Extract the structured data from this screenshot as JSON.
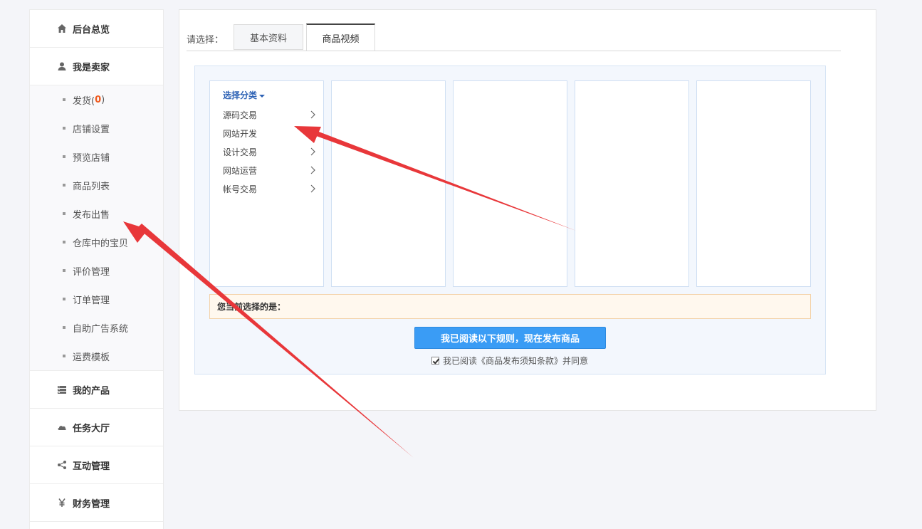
{
  "sidebar": {
    "sections": [
      {
        "label": "后台总览",
        "icon": "home-icon"
      },
      {
        "label": "我是卖家",
        "icon": "user-icon"
      }
    ],
    "seller_items": [
      {
        "label": "发货(",
        "count": "0",
        "suffix": ")"
      },
      {
        "label": "店铺设置"
      },
      {
        "label": "预览店铺"
      },
      {
        "label": "商品列表"
      },
      {
        "label": "发布出售"
      },
      {
        "label": "仓库中的宝贝"
      },
      {
        "label": "评价管理"
      },
      {
        "label": "订单管理"
      },
      {
        "label": "自助广告系统"
      },
      {
        "label": "运费模板"
      }
    ],
    "more_sections": [
      {
        "label": "我的产品",
        "icon": "products-icon"
      },
      {
        "label": "任务大厅",
        "icon": "cloud-icon"
      },
      {
        "label": "互动管理",
        "icon": "share-icon"
      },
      {
        "label": "财务管理",
        "icon": "yen-icon"
      }
    ]
  },
  "tabs": {
    "prompt": "请选择：",
    "items": [
      {
        "label": "基本资料",
        "active": false
      },
      {
        "label": "商品视频",
        "active": true
      }
    ]
  },
  "category": {
    "title": "选择分类",
    "items": [
      "源码交易",
      "网站开发",
      "设计交易",
      "网站运营",
      "帐号交易"
    ]
  },
  "current_selection_label": "您当前选择的是：",
  "agree_button": "我已阅读以下规则，现在发布商品",
  "terms_text": "我已阅读《商品发布须知条款》并同意",
  "terms_checked": true,
  "colors": {
    "accent": "#3a9cf5",
    "count": "#ef5a1e",
    "annotation_arrow": "#e8373a"
  }
}
